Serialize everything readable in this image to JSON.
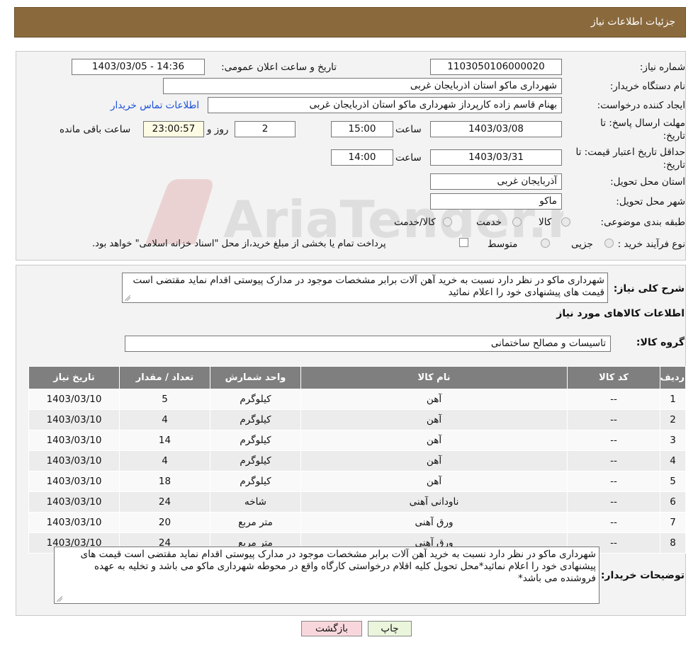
{
  "header": {
    "title": "جزئیات اطلاعات نیاز"
  },
  "form": {
    "need_number_label": "شماره نیاز:",
    "need_number": "1103050106000020",
    "announce_label": "تاریخ و ساعت اعلان عمومی:",
    "announce_value": "1403/03/05 - 14:36",
    "buyer_label": "نام دستگاه خریدار:",
    "buyer_value": "شهرداری ماکو استان اذربایجان غربی",
    "creator_label": "ایجاد کننده درخواست:",
    "creator_value": "بهنام قاسم زاده کارپرداز شهرداری ماکو استان اذربایجان غربی",
    "contact_link": "اطلاعات تماس خریدار",
    "deadline_label_1": "مهلت ارسال پاسخ: تا",
    "deadline_label_2": "تاریخ:",
    "deadline_date": "1403/03/08",
    "time_label": "ساعت",
    "deadline_time": "15:00",
    "days_value": "2",
    "days_label": "روز و",
    "remaining_time": "23:00:57",
    "remaining_label": "ساعت باقی مانده",
    "validity_label_1": "حداقل تاریخ اعتبار قیمت: تا",
    "validity_label_2": "تاریخ:",
    "validity_date": "1403/03/31",
    "validity_time_label": "ساعت",
    "validity_time": "14:00",
    "province_label": "استان محل تحویل:",
    "province_value": "آذربایجان غربی",
    "city_label": "شهر محل تحویل:",
    "city_value": "ماکو",
    "category_label": "طبقه بندی موضوعی:",
    "category_options": [
      "کالا",
      "خدمت",
      "کالا/خدمت"
    ],
    "process_label": "نوع فرآیند خرید :",
    "process_options": [
      "جزیی",
      "متوسط"
    ],
    "process_note": "پرداخت تمام یا بخشی از مبلغ خرید،از محل \"اسناد خزانه اسلامی\" خواهد بود."
  },
  "summary": {
    "label": "شرح کلی نیاز:",
    "text": "شهرداری ماکو در نظر دارد نسبت به خرید آهن آلات برابر مشخصات موجود در مدارک پیوستی اقدام نماید مقتضی است قیمت های پیشنهادی خود را اعلام نمائید",
    "goods_title": "اطلاعات کالاهای مورد نیاز",
    "group_label": "گروه کالا:",
    "group_value": "تاسیسات و مصالح ساختمانی"
  },
  "table": {
    "headers": [
      "ردیف",
      "کد کالا",
      "نام کالا",
      "واحد شمارش",
      "تعداد / مقدار",
      "تاریخ نیاز"
    ],
    "rows": [
      [
        "1",
        "--",
        "آهن",
        "کیلوگرم",
        "5",
        "1403/03/10"
      ],
      [
        "2",
        "--",
        "آهن",
        "کیلوگرم",
        "4",
        "1403/03/10"
      ],
      [
        "3",
        "--",
        "آهن",
        "کیلوگرم",
        "14",
        "1403/03/10"
      ],
      [
        "4",
        "--",
        "آهن",
        "کیلوگرم",
        "4",
        "1403/03/10"
      ],
      [
        "5",
        "--",
        "آهن",
        "کیلوگرم",
        "18",
        "1403/03/10"
      ],
      [
        "6",
        "--",
        "ناودانی آهنی",
        "شاخه",
        "24",
        "1403/03/10"
      ],
      [
        "7",
        "--",
        "ورق آهنی",
        "متر مربع",
        "20",
        "1403/03/10"
      ],
      [
        "8",
        "--",
        "ورق آهنی",
        "متر مربع",
        "24",
        "1403/03/10"
      ]
    ]
  },
  "buyer_notes": {
    "label": "توضیحات خریدار:",
    "text": "شهرداری ماکو در نظر دارد نسبت به خرید آهن آلات برابر مشخصات موجود در مدارک پیوستی اقدام نماید مقتضی است قیمت های پیشنهادی خود را اعلام نمائید*محل تحویل کلیه اقلام درخواستی کارگاه واقع در محوطه شهرداری ماکو می باشد و تخلیه به عهده فروشنده می باشد*"
  },
  "buttons": {
    "print": "چاپ",
    "back": "بازگشت"
  },
  "watermark": {
    "text": "AriaTender.neT"
  },
  "colors": {
    "header": "#8a6a3d",
    "table_header": "#7f7f7f",
    "link": "#1a4fd8",
    "back_button": "#f8d7dc",
    "print_button": "#eaf5dc"
  }
}
